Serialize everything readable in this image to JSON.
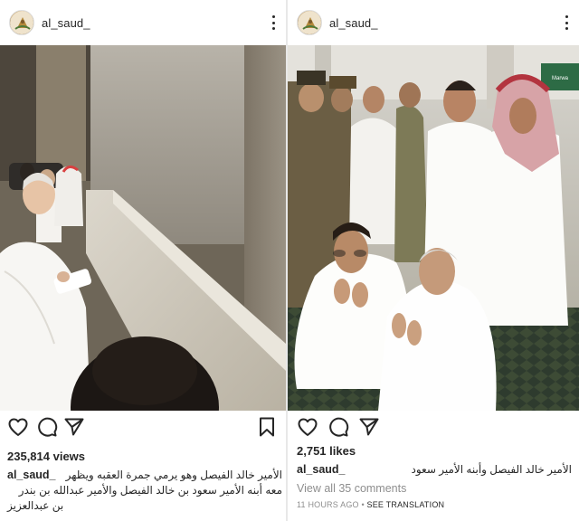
{
  "posts": [
    {
      "username": "al_saud_",
      "metric_label": "235,814 views",
      "caption_user": "al_saud_",
      "caption_lines": [
        "الأمير خالد الفيصل وهو يرمي جمرة العقبه ويظهر",
        "معه أبنه الأمير سعود بن خالد الفيصل والأمير عبدالله بن بندر",
        "بن عبدالعزيز"
      ]
    },
    {
      "username": "al_saud_",
      "metric_label": "2,751 likes",
      "caption_user": "al_saud_",
      "caption_text": "الأمير خالد الفيصل وأبنه الأمير سعود",
      "comments_link": "View all 35 comments",
      "timestamp": "11 HOURS AGO",
      "separator": "•",
      "translation_link": "SEE TRANSLATION",
      "sign_text": "Marwa"
    }
  ],
  "icons": {
    "like": "heart-icon",
    "comment": "comment-icon",
    "share": "share-icon",
    "save": "bookmark-icon",
    "more": "more-options-icon"
  }
}
